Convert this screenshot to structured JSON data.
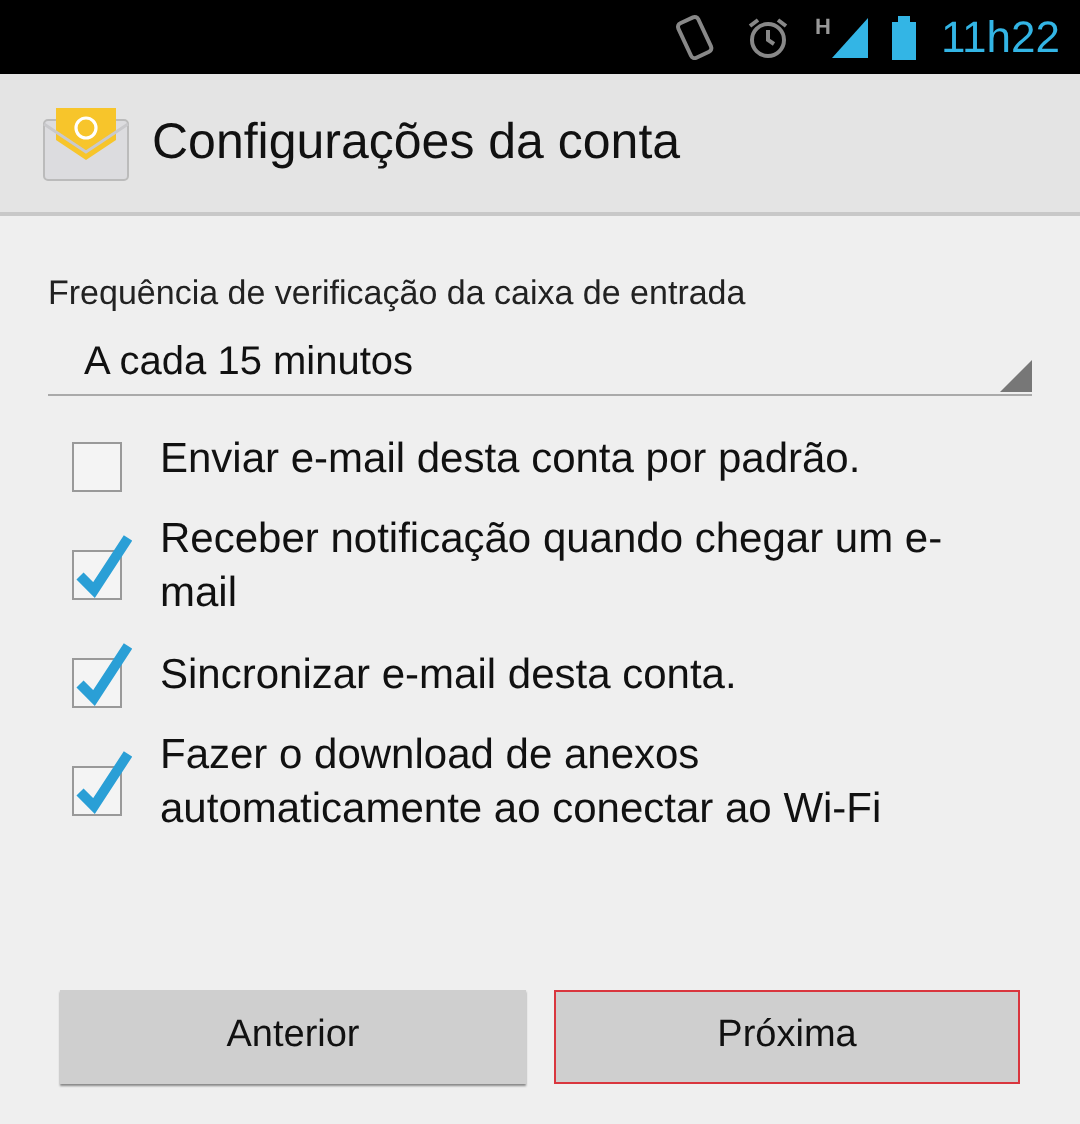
{
  "status_bar": {
    "network_type": "H",
    "time": "11h22"
  },
  "header": {
    "title": "Configurações da conta"
  },
  "frequency": {
    "label": "Frequência de verificação da caixa de entrada",
    "value": "A cada 15 minutos"
  },
  "options": [
    {
      "label": "Enviar e-mail desta conta por padrão.",
      "checked": false
    },
    {
      "label": "Receber notificação quando chegar um e-mail",
      "checked": true
    },
    {
      "label": "Sincronizar e-mail desta conta.",
      "checked": true
    },
    {
      "label": "Fazer o download de anexos automaticamente ao conectar ao Wi-Fi",
      "checked": true
    }
  ],
  "buttons": [
    {
      "label": "Anterior",
      "focused": false
    },
    {
      "label": "Próxima",
      "focused": true
    }
  ]
}
